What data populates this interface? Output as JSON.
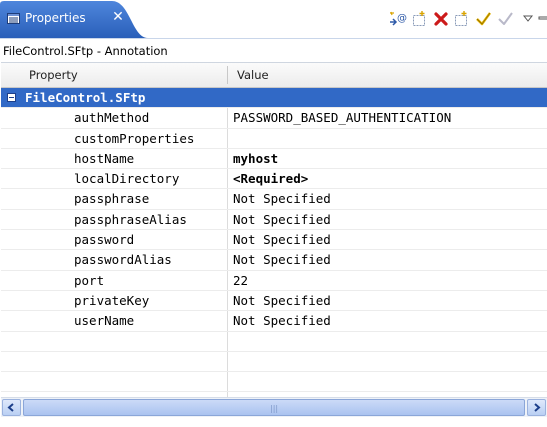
{
  "tab": {
    "label": "Properties",
    "close": "✕"
  },
  "toolbar": {
    "icons": [
      "insert-annotation-icon",
      "new-item-icon",
      "delete-icon",
      "new-item-icon-2",
      "validate-icon",
      "refresh-icon",
      "view-menu-icon",
      "minimize-icon",
      "maximize-icon"
    ]
  },
  "annotation_title": "FileControl.SFtp - Annotation",
  "table": {
    "columns": [
      "Property",
      "Value"
    ],
    "category": "FileControl.SFtp",
    "rows": [
      {
        "property": "authMethod",
        "value": "PASSWORD_BASED_AUTHENTICATION",
        "bold": false
      },
      {
        "property": "customProperties",
        "value": "",
        "bold": false
      },
      {
        "property": "hostName",
        "value": "myhost",
        "bold": true
      },
      {
        "property": "localDirectory",
        "value": "<Required>",
        "bold": true
      },
      {
        "property": "passphrase",
        "value": "Not Specified",
        "bold": false
      },
      {
        "property": "passphraseAlias",
        "value": "Not Specified",
        "bold": false
      },
      {
        "property": "password",
        "value": "Not Specified",
        "bold": false
      },
      {
        "property": "passwordAlias",
        "value": "Not Specified",
        "bold": false
      },
      {
        "property": "port",
        "value": "22",
        "bold": false
      },
      {
        "property": "privateKey",
        "value": "Not Specified",
        "bold": false
      },
      {
        "property": "userName",
        "value": "Not Specified",
        "bold": false
      }
    ]
  },
  "scrollbar": {
    "grip": "|||"
  },
  "colors": {
    "tab_active": "#3169c6",
    "selection": "#3169c6",
    "accent_red": "#cc1a1a"
  }
}
